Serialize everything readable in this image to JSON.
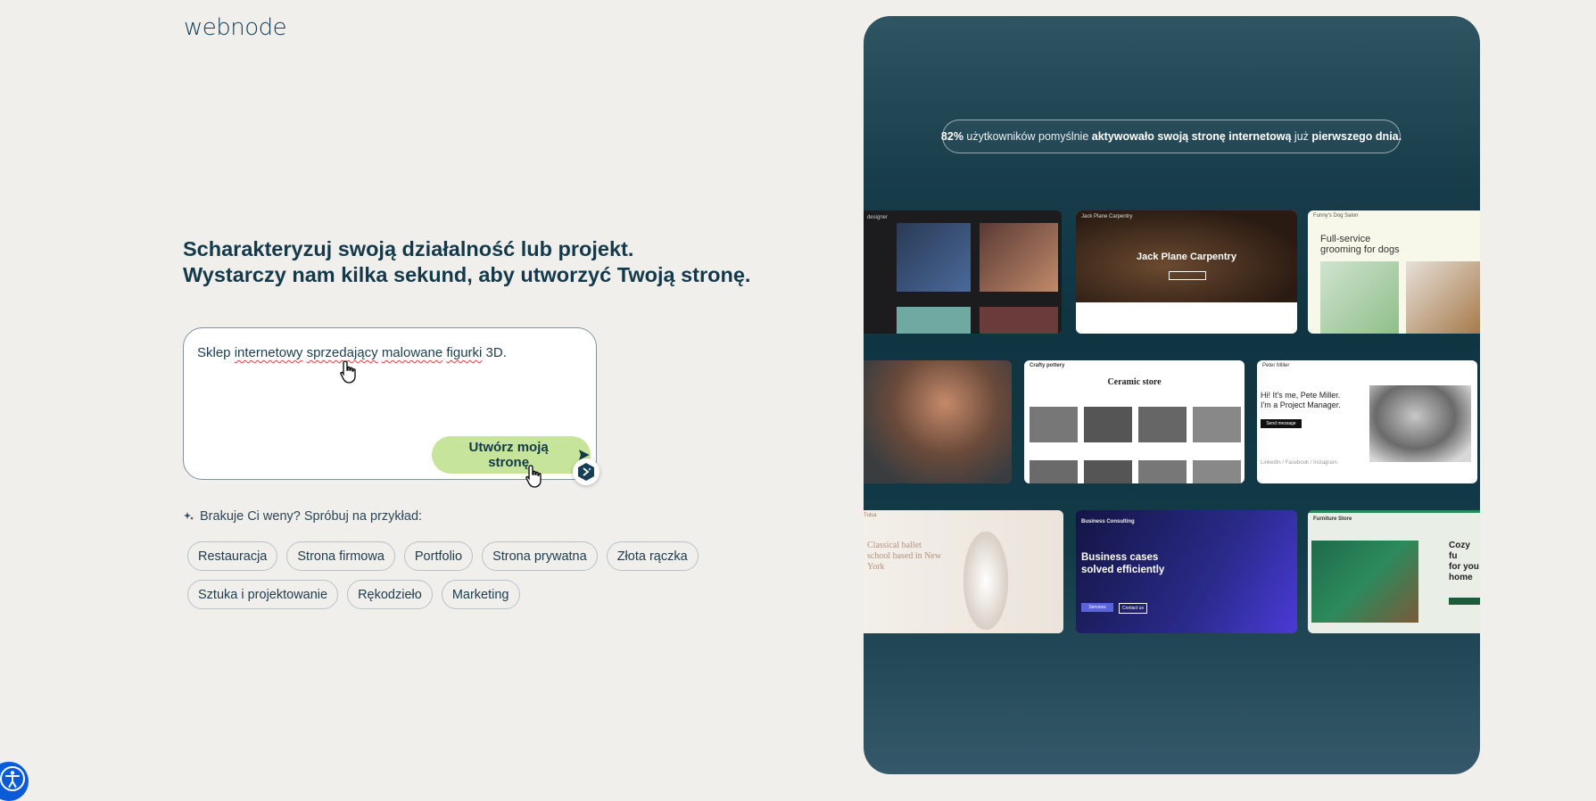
{
  "brand": {
    "logo_text": "webnode"
  },
  "headline": {
    "line1": "Scharakteryzuj swoją działalność lub projekt.",
    "line2": "Wystarczy nam kilka sekund, aby utworzyć Twoją stronę."
  },
  "prompt": {
    "value_words": [
      "Sklep",
      "internetowy",
      "sprzedający",
      "malowane",
      "figurki",
      "3D."
    ],
    "button_label": "Utwórz moją stronę"
  },
  "examples": {
    "hint": "Brakuje Ci weny? Spróbuj na przykład:",
    "row1": [
      "Restauracja",
      "Strona firmowa",
      "Portfolio",
      "Strona prywatna",
      "Złota rączka"
    ],
    "row2": [
      "Sztuka i projektowanie",
      "Rękodzieło",
      "Marketing"
    ]
  },
  "stat": {
    "pct": "82%",
    "t1": " użytkowników pomyślnie ",
    "b1": "aktywowało swoją stronę internetową",
    "t2": " już ",
    "b2": "pierwszego dnia."
  },
  "thumbnails": {
    "designer": {
      "brand": "designer"
    },
    "carpentry": {
      "brand": "Jack Plane Carpentry",
      "title": "Jack Plane Carpentry"
    },
    "dog_salon": {
      "brand": "Funny's Dog Salon",
      "title_l1": "Full-service",
      "title_l2": "grooming for dogs"
    },
    "pottery": {
      "brand": "Crafty pottery",
      "title": "Ceramic store"
    },
    "manager": {
      "brand": "Peter Miller",
      "l1": "Hi! It's me, Pete Miller.",
      "l2": "I'm a Project Manager.",
      "cta": "Send message",
      "links": "LinkedIn / Facebook / Instagram"
    },
    "ballet": {
      "brand": "Tulsa",
      "l1": "Classical ballet",
      "l2": "school based in New",
      "l3": "York"
    },
    "consulting": {
      "brand": "Business Consulting",
      "l1": "Business cases",
      "l2": "solved efficiently",
      "btn1": "Services",
      "btn2": "Contact us"
    },
    "furniture": {
      "brand": "Furniture Store",
      "l1": "Cozy fu",
      "l2": "for you",
      "l3": "home"
    }
  },
  "colors": {
    "page_bg": "#f1efec",
    "text_dark": "#13394a",
    "button_green": "#c7e59a",
    "panel_dark": "#0f3442",
    "accessibility_blue": "#0a5bd8"
  },
  "icons": [
    "send-arrow-icon",
    "ai-sparkle-icon",
    "hand-cursor-icon",
    "accessibility-icon"
  ]
}
